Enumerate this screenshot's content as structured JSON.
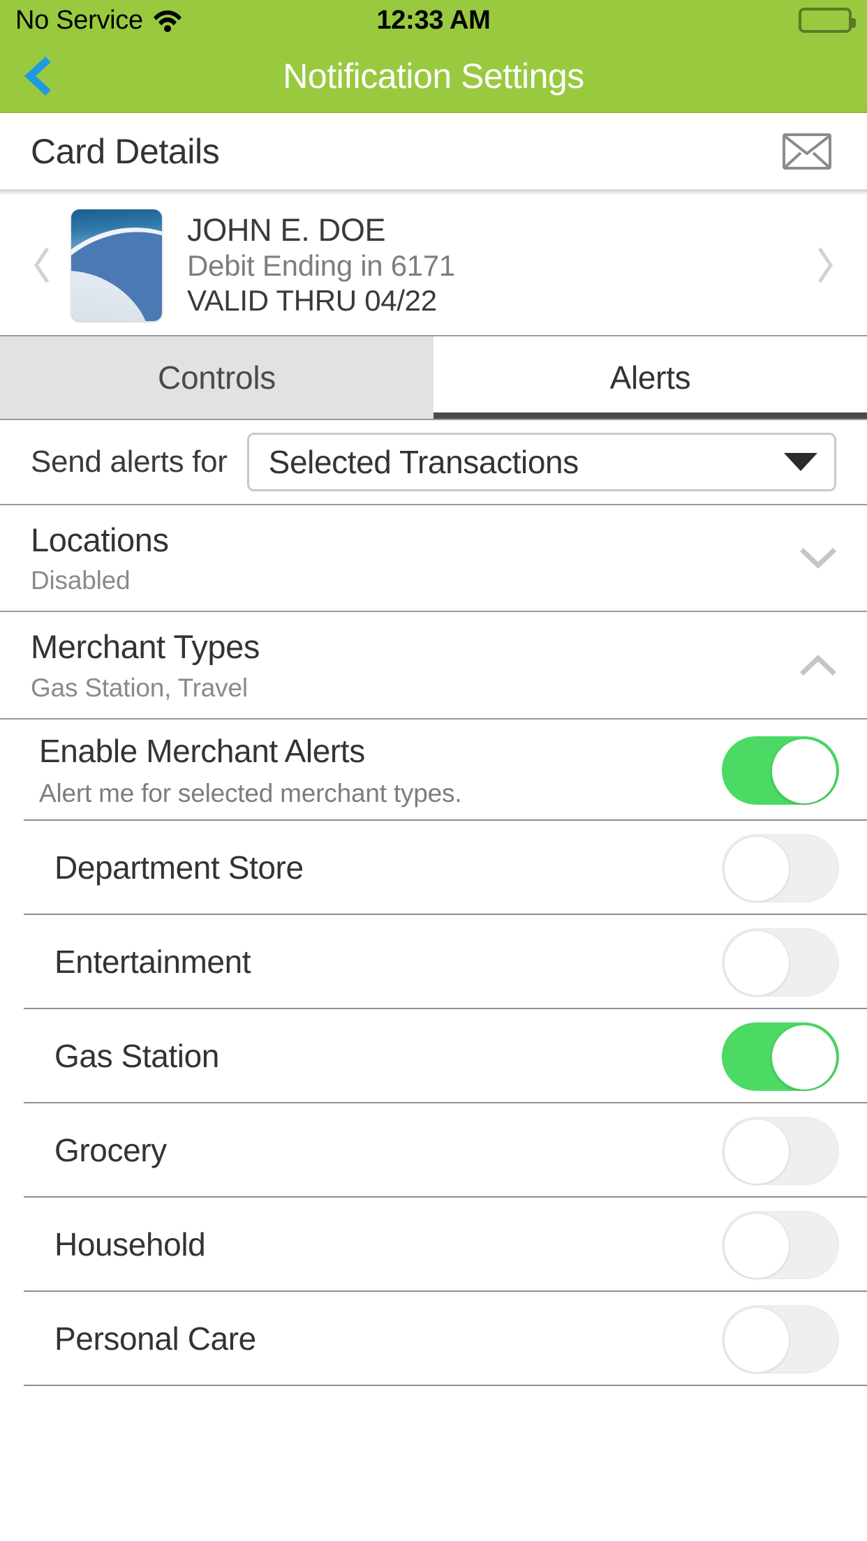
{
  "status_bar": {
    "carrier": "No Service",
    "time": "12:33 AM",
    "wifi_icon": "wifi-icon",
    "battery_icon": "battery-full-icon"
  },
  "nav": {
    "title": "Notification Settings",
    "back_icon": "chevron-left-icon",
    "accent_green": "#99c93f",
    "back_blue": "#1e9be0"
  },
  "card_details": {
    "title": "Card Details",
    "mail_icon": "envelope-icon"
  },
  "carousel": {
    "prev_icon": "chevron-left-icon",
    "next_icon": "chevron-right-icon",
    "card": {
      "name": "JOHN E. DOE",
      "account": "Debit Ending in 6171",
      "valid_thru": "VALID THRU 04/22",
      "art": "blue-abstract-card-art"
    }
  },
  "tabs": [
    {
      "label": "Controls",
      "active": false
    },
    {
      "label": "Alerts",
      "active": true
    }
  ],
  "send_alerts": {
    "label": "Send alerts for",
    "selected": "Selected Transactions",
    "caret_icon": "chevron-down-icon",
    "options": [
      "Selected Transactions"
    ]
  },
  "sections": [
    {
      "title": "Locations",
      "subtitle": "Disabled",
      "expanded": false,
      "chevron_icon": "chevron-down-icon"
    },
    {
      "title": "Merchant Types",
      "subtitle": "Gas Station, Travel",
      "expanded": true,
      "chevron_icon": "chevron-up-icon"
    }
  ],
  "merchant_master": {
    "title": "Enable Merchant Alerts",
    "subtitle": "Alert me for selected merchant types.",
    "on": true
  },
  "merchant_types": [
    {
      "label": "Department Store",
      "on": false
    },
    {
      "label": "Entertainment",
      "on": false
    },
    {
      "label": "Gas Station",
      "on": true
    },
    {
      "label": "Grocery",
      "on": false
    },
    {
      "label": "Household",
      "on": false
    },
    {
      "label": "Personal Care",
      "on": false
    }
  ],
  "colors": {
    "header_green": "#99c93f",
    "toggle_on_green": "#4cd964",
    "toggle_off_gray": "#efefef",
    "back_blue": "#1e9be0",
    "tab_inactive_bg": "#e2e2e2"
  }
}
